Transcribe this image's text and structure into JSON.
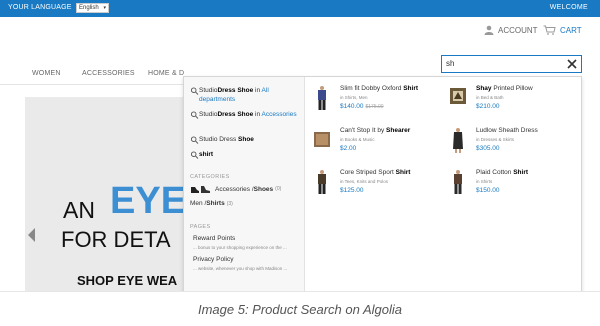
{
  "topbar": {
    "language_label": "YOUR LANGUAGE",
    "language_value": "English",
    "welcome": "WELCOME"
  },
  "header": {
    "account": "ACCOUNT",
    "cart": "CART"
  },
  "search": {
    "value": "sh"
  },
  "nav": {
    "items": [
      "WOMEN",
      "ACCESSORIES",
      "HOME & D"
    ]
  },
  "hero": {
    "line1": "AN",
    "highlight": "EYE",
    "line2": "FOR DETA",
    "line3": "SHOP EYE WEA"
  },
  "suggestions": [
    {
      "prefix": "Studio",
      "b1": "Dress",
      "mid": " ",
      "b2": "Shoe",
      "suffix": " in ",
      "link": "All departments"
    },
    {
      "prefix": "Studio",
      "b1": "Dress",
      "mid": " ",
      "b2": "Shoe",
      "suffix": " in ",
      "link": "Accessories"
    },
    {
      "prefix": "Studio Dress ",
      "b1": "Shoe",
      "mid": "",
      "b2": "",
      "suffix": "",
      "link": ""
    },
    {
      "prefix": "",
      "b1": "shirt",
      "mid": "",
      "b2": "",
      "suffix": "",
      "link": ""
    }
  ],
  "categories": {
    "title": "CATEGORIES",
    "items": [
      {
        "label": "Accessories / ",
        "bold": "Shoes",
        "count": "(0)"
      },
      {
        "label": "Men / ",
        "bold": "Shirts",
        "count": "(3)"
      }
    ]
  },
  "pages": {
    "title": "PAGES",
    "items": [
      {
        "title": "Reward Points",
        "snippet": "... bonus to your shopping experience on the ..."
      },
      {
        "title": "Privacy Policy",
        "snippet": "... website, whenever you shop with Madison ..."
      }
    ]
  },
  "products": [
    {
      "name_pre": "Slim fit Dobby Oxford ",
      "name_b": "Shirt",
      "in": "in Shirts, Men",
      "price": "$140.00",
      "old": "$175.00"
    },
    {
      "name_pre": "",
      "name_b": "Shay",
      "name_post": " Printed Pillow",
      "in": "in Bed & Bath",
      "price": "$210.00",
      "old": ""
    },
    {
      "name_pre": "Can't Stop It by ",
      "name_b": "Shearer",
      "in": "in Books & Music",
      "price": "$2.00",
      "old": ""
    },
    {
      "name_pre": "Ludlow Sheath Dress",
      "name_b": "",
      "in": "in Dresses & Skirts",
      "price": "$305.00",
      "old": ""
    },
    {
      "name_pre": "Core Striped Sport ",
      "name_b": "Shirt",
      "in": "in Tees, Knits and Polos",
      "price": "$125.00",
      "old": ""
    },
    {
      "name_pre": "Plaid Cotton ",
      "name_b": "Shirt",
      "in": "in Shirts",
      "price": "$150.00",
      "old": ""
    }
  ],
  "caption": "Image 5: Product Search on Algolia",
  "colors": {
    "accent": "#1979c3",
    "hero_eye": "#3d8fd3"
  }
}
